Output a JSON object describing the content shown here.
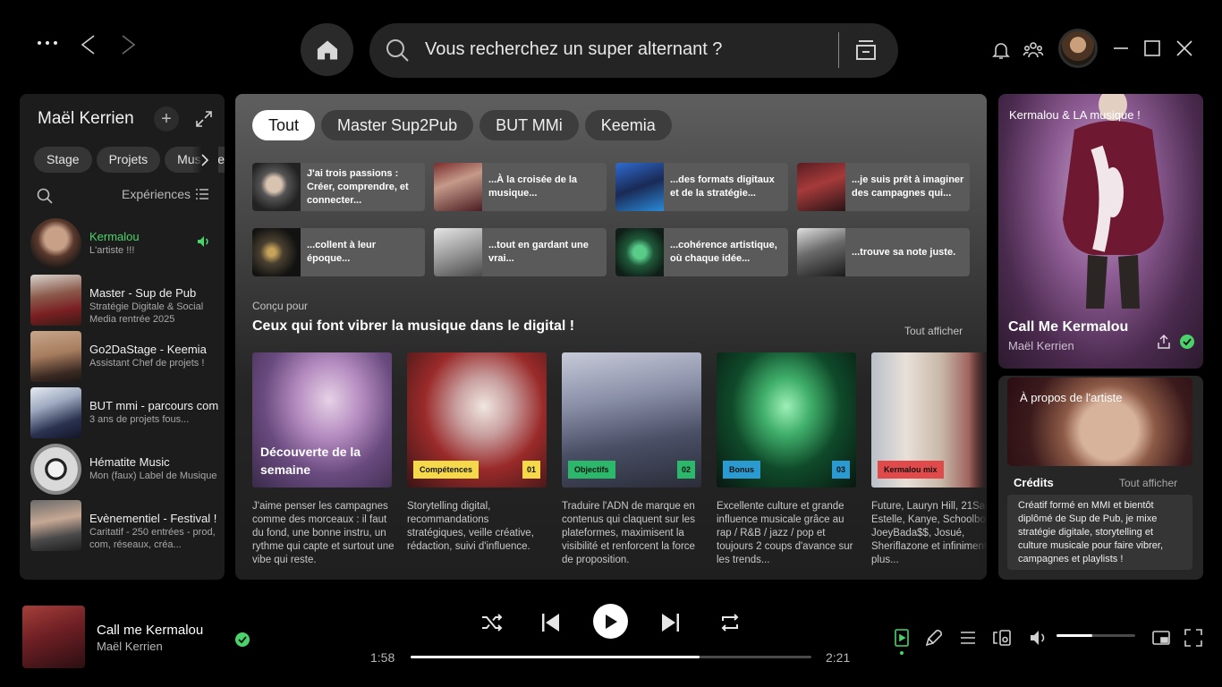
{
  "search": {
    "placeholder": "Vous recherchez un super alternant ?"
  },
  "sidebar": {
    "title": "Maël Kerrien",
    "chips": [
      "Stage",
      "Projets",
      "Musique"
    ],
    "sort_label": "Expériences",
    "items": [
      {
        "name": "Kermalou",
        "sub": "L'artiste !!!",
        "active": true
      },
      {
        "name": "Master - Sup de Pub",
        "sub": "Stratégie Digitale & Social Media rentrée 2025"
      },
      {
        "name": "Go2DaStage - Keemia",
        "sub": "Assistant Chef de projets !"
      },
      {
        "name": "BUT mmi - parcours com",
        "sub": "3 ans de projets fous..."
      },
      {
        "name": "Hématite Music",
        "sub": "Mon (faux) Label de Musique"
      },
      {
        "name": "Evènementiel - Festival !",
        "sub": "Caritatif - 250 entrées - prod, com, réseaux, créa..."
      }
    ]
  },
  "center": {
    "filters": [
      "Tout",
      "Master Sup2Pub",
      "BUT MMi",
      "Keemia"
    ],
    "quick_picks": [
      "J'ai trois passions : Créer, comprendre, et connecter...",
      "...À la croisée de la musique...",
      "...des formats digitaux et de la stratégie...",
      "...je suis prêt à imaginer des campagnes qui...",
      "...collent à leur époque...",
      "...tout en gardant une vrai...",
      "...cohérence artistique, où chaque idée...",
      "...trouve sa note juste."
    ],
    "section_kicker": "Conçu pour",
    "section_title": "Ceux qui font vibrer la musique dans le digital !",
    "section_all": "Tout afficher",
    "cards": [
      {
        "overlay": "Découverte de la semaine",
        "desc": "J'aime penser les campagnes comme des morceaux : il faut du fond, une bonne instru, un rythme qui capte et surtout une vibe qui reste."
      },
      {
        "tag": "Compétences",
        "num": "01",
        "desc": "Storytelling digital, recommandations stratégiques, veille créative, rédaction, suivi d'influence."
      },
      {
        "tag": "Objectifs",
        "num": "02",
        "desc": "Traduire l'ADN de marque en contenus qui claquent sur les plateformes, maximisent la visibilité et renforcent la force de proposition."
      },
      {
        "tag": "Bonus",
        "num": "03",
        "desc": "Excellente culture et grande influence musicale grâce au rap / R&B / jazz / pop et toujours 2 coups d'avance sur les trends..."
      },
      {
        "tag": "Kermalou mix",
        "desc": "Future, Lauryn Hill, 21Savage, Estelle, Kanye, SchoolboyQ, JoeyBada$$, Josué, Sheriflazone et infiniment plus..."
      }
    ]
  },
  "right_panel": {
    "title": "Kermalou & LA musique !",
    "track": "Call Me Kermalou",
    "artist": "Maël Kerrien",
    "about_title": "À propos de l'artiste",
    "credits_label": "Crédits",
    "credits_all": "Tout afficher",
    "credits_text": "Créatif formé en MMI et bientôt diplômé de Sup de Pub, je mixe stratégie digitale, storytelling et culture musicale pour faire vibrer, campagnes et playlists !"
  },
  "player": {
    "title": "Call me Kermalou",
    "artist": "Maël Kerrien",
    "elapsed": "1:58",
    "total": "2:21",
    "progress": 0.72,
    "volume": 0.45
  },
  "colors": {
    "accent": "#4ad36a",
    "background": "#000000",
    "panel": "#1c1c1c"
  }
}
